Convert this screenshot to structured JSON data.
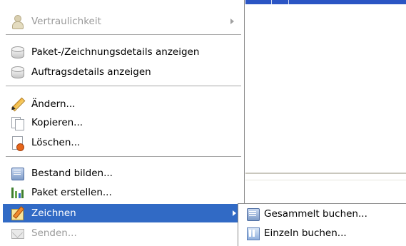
{
  "menu": {
    "items": [
      {
        "label": "Vertraulichkeit",
        "icon": "person-icon",
        "enabled": false,
        "submenu": true
      },
      {
        "label": "Paket-/Zeichnungsdetails anzeigen",
        "icon": "database-icon",
        "enabled": true
      },
      {
        "label": "Auftragsdetails anzeigen",
        "icon": "database-icon",
        "enabled": true
      },
      {
        "label": "Ändern...",
        "icon": "pencil-icon",
        "enabled": true
      },
      {
        "label": "Kopieren...",
        "icon": "copy-icon",
        "enabled": true
      },
      {
        "label": "Löschen...",
        "icon": "delete-document-icon",
        "enabled": true
      },
      {
        "label": "Bestand bilden...",
        "icon": "stock-icon",
        "enabled": true
      },
      {
        "label": "Paket erstellen...",
        "icon": "package-chart-icon",
        "enabled": true
      },
      {
        "label": "Zeichnen",
        "icon": "draw-icon",
        "enabled": true,
        "selected": true,
        "submenu": true
      },
      {
        "label": "Senden...",
        "icon": "send-icon",
        "enabled": false
      }
    ]
  },
  "submenu": {
    "items": [
      {
        "label": "Gesammelt buchen...",
        "icon": "collective-booking-icon"
      },
      {
        "label": "Einzeln buchen...",
        "icon": "single-booking-icon"
      }
    ]
  },
  "colors": {
    "selection": "#316ac5",
    "title_bar": "#2b55c4",
    "disabled_text": "#9a9a9a"
  }
}
